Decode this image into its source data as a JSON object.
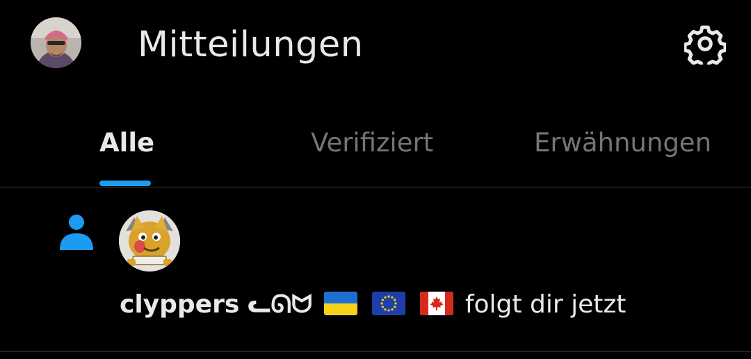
{
  "header": {
    "title": "Mitteilungen",
    "avatar_icon": "user-avatar-icon",
    "settings_icon": "gear-icon"
  },
  "tabs": [
    {
      "label": "Alle",
      "active": true
    },
    {
      "label": "Verifiziert",
      "active": false
    },
    {
      "label": "Erwähnungen",
      "active": false
    }
  ],
  "colors": {
    "background": "#000000",
    "primary_text": "#e7e9ea",
    "secondary_text": "#71767b",
    "accent": "#1d9bf0",
    "divider": "#2f3336"
  },
  "notifications": [
    {
      "type_icon": "person-follow-icon",
      "avatar_icon": "follower-avatar-icon",
      "name": "clyppers",
      "name_symbols": "ᓚᘏᗢ",
      "flags": [
        "ukraine-flag-icon",
        "eu-flag-icon",
        "canada-flag-icon"
      ],
      "action_text": "folgt dir jetzt"
    }
  ]
}
